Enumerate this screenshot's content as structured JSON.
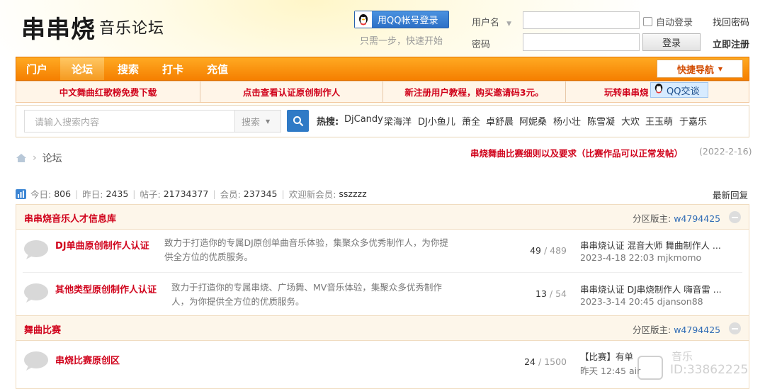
{
  "header": {
    "logo_main": "串串烧",
    "logo_sub": "音乐论坛",
    "qq_login_label": "用QQ帐号登录",
    "qq_hint": "只需一步，快速开始",
    "username_label": "用户名",
    "password_label": "密码",
    "auto_login_label": "自动登录",
    "forgot_password": "找回密码",
    "login_button": "登录",
    "register_link": "立即注册"
  },
  "nav": {
    "items": [
      {
        "label": "门户"
      },
      {
        "label": "论坛"
      },
      {
        "label": "搜索"
      },
      {
        "label": "打卡"
      },
      {
        "label": "充值"
      }
    ],
    "quick_nav": "快捷导航"
  },
  "promo": {
    "items": [
      {
        "label": "中文舞曲红歌榜免费下载"
      },
      {
        "label": "点击查看认证原创制作人"
      },
      {
        "label": "新注册用户教程，购买邀请码3元。"
      },
      {
        "label": "玩转串串烧"
      }
    ],
    "qq_chat": "QQ交谈"
  },
  "search": {
    "placeholder": "请输入搜索内容",
    "type": "搜索",
    "hot_label": "热搜:",
    "hot_items": [
      "DjCandy",
      "梁海洋",
      "DJ小鱼儿",
      "萧全",
      "卓舒晨",
      "阿妮桑",
      "杨小壮",
      "陈雪凝",
      "大欢",
      "王玉萌",
      "于嘉乐"
    ]
  },
  "breadcrumb": {
    "current": "论坛"
  },
  "notice": {
    "text": "串烧舞曲比赛细则以及要求（比赛作品可以正常发帖）",
    "date": "(2022-2-16)"
  },
  "stats": {
    "today_label": "今日:",
    "today": "806",
    "yesterday_label": "昨日:",
    "yesterday": "2435",
    "posts_label": "帖子:",
    "posts": "21734377",
    "members_label": "会员:",
    "members": "237345",
    "welcome_label": "欢迎新会员:",
    "welcome_user": "sszzzz",
    "latest_reply": "最新回复"
  },
  "sections": [
    {
      "title": "串串烧音乐人才信息库",
      "mod_label": "分区版主:",
      "mod_name": "w4794425",
      "forums": [
        {
          "name": "DJ单曲原创制作人认证",
          "desc": "致力于打造你的专属DJ原创单曲音乐体验，集聚众多优秀制作人，为你提供全方位的优质服务。",
          "threads": "49",
          "posts": "489",
          "last_title": "串串烧认证 混音大师 舞曲制作人 ...",
          "last_meta": "2023-4-18 22:03 mjkmomo"
        },
        {
          "name": "其他类型原创制作人认证",
          "desc": "致力于打造你的专属串烧、广场舞、MV音乐体验，集聚众多优秀制作人，为你提供全方位的优质服务。",
          "threads": "13",
          "posts": "54",
          "last_title": "串串烧认证 DJ串烧制作人 嗨音雷 ...",
          "last_meta": "2023-3-14 20:45 djanson88"
        }
      ]
    },
    {
      "title": "舞曲比赛",
      "mod_label": "分区版主:",
      "mod_name": "w4794425",
      "forums": [
        {
          "name": "串烧比赛原创区",
          "desc": "",
          "threads": "24",
          "posts": "1500",
          "last_title": "【比赛】有单",
          "last_meta": "昨天 12:45 air"
        }
      ]
    }
  ],
  "watermark": {
    "brand": "音乐",
    "id": "ID:33862225"
  },
  "colors": {
    "nav_orange": "#f57f00",
    "accent_red": "#d0021b",
    "link_blue": "#2f6bb5"
  }
}
